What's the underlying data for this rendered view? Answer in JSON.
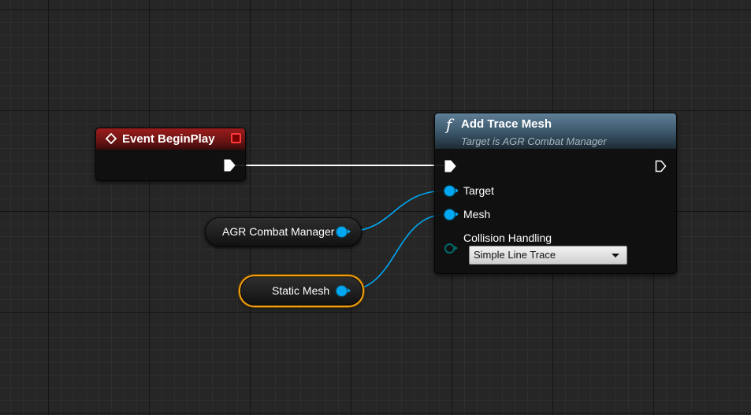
{
  "event_node": {
    "title": "Event BeginPlay",
    "header_color": "#8a1a1a"
  },
  "function_node": {
    "title": "Add Trace Mesh",
    "subtitle": "Target is AGR Combat Manager",
    "header_color": "#4a6a82",
    "pins": {
      "target_label": "Target",
      "mesh_label": "Mesh",
      "collision_label": "Collision Handling"
    },
    "collision_dropdown": {
      "selected": "Simple Line Trace"
    }
  },
  "variables": {
    "agr_combat_manager": "AGR Combat Manager",
    "static_mesh": "Static Mesh"
  },
  "colors": {
    "object_pin": "#00a8f3",
    "exec_wire": "#ffffff",
    "selection_outline": "#f0a113",
    "enum_pin": "#00686a"
  },
  "icons": {
    "event": "event-diamond-icon",
    "function": "function-f-icon",
    "delegate": "delegate-pin-icon"
  }
}
